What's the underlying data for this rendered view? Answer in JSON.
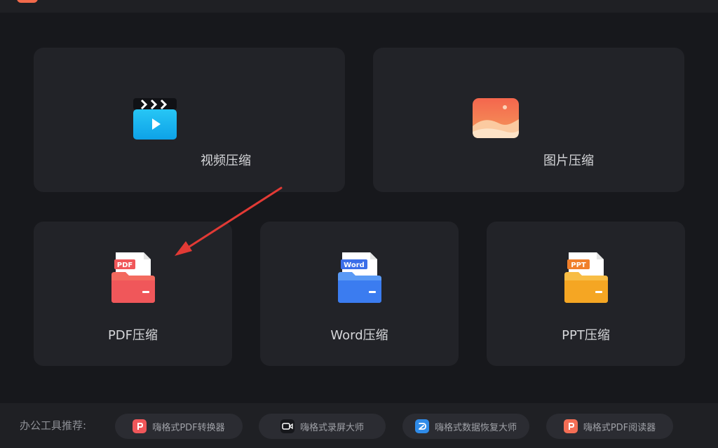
{
  "cards": {
    "video": {
      "title": "视频压缩"
    },
    "image": {
      "title": "图片压缩"
    },
    "pdf": {
      "title": "PDF压缩",
      "badge": "PDF"
    },
    "word": {
      "title": "Word压缩",
      "badge": "Word"
    },
    "ppt": {
      "title": "PPT压缩",
      "badge": "PPT"
    }
  },
  "footer": {
    "label": "办公工具推荐:",
    "items": [
      {
        "label": "嗨格式PDF转换器",
        "icon": "pdf-converter-icon"
      },
      {
        "label": "嗨格式录屏大师",
        "icon": "screen-recorder-icon"
      },
      {
        "label": "嗨格式数据恢复大师",
        "icon": "data-recovery-icon"
      },
      {
        "label": "嗨格式PDF阅读器",
        "icon": "pdf-reader-icon"
      }
    ]
  },
  "colors": {
    "background": "#17181c",
    "card": "#222328",
    "pdf": "#f0575a",
    "word": "#3b7cf0",
    "ppt": "#f5a623",
    "arrow": "#e23a35"
  }
}
